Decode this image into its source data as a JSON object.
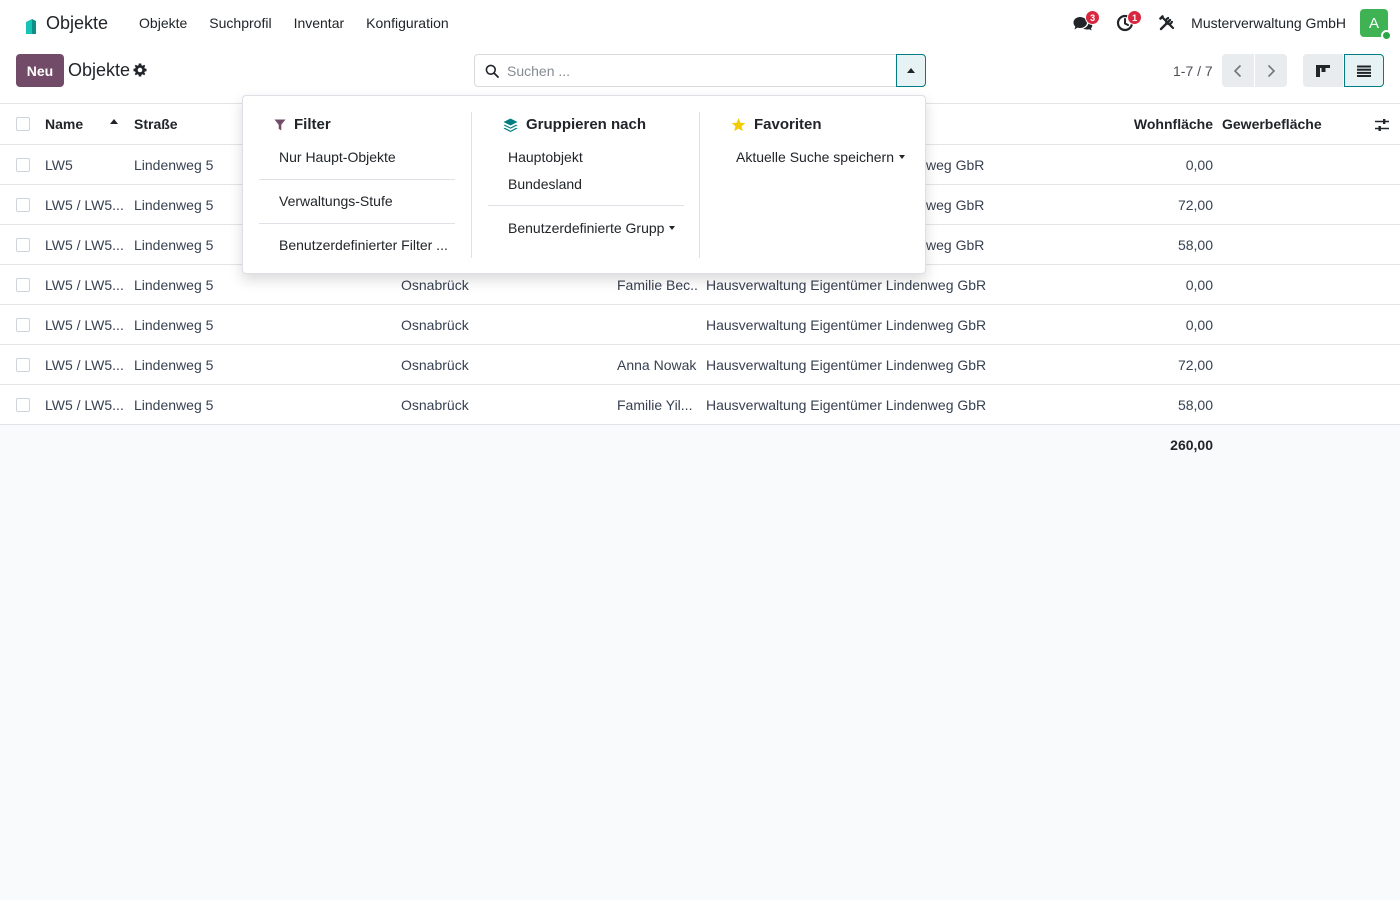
{
  "navbar": {
    "app_title": "Objekte",
    "menu": [
      "Objekte",
      "Suchprofil",
      "Inventar",
      "Konfiguration"
    ],
    "messages_badge": "3",
    "activities_badge": "1",
    "company": "Musterverwaltung GmbH",
    "avatar_initial": "A"
  },
  "control_panel": {
    "new_button": "Neu",
    "title": "Objekte",
    "search_placeholder": "Suchen ...",
    "pager": "1-7 / 7"
  },
  "table": {
    "columns": [
      "Name",
      "Straße",
      "Wohnfläche",
      "Gewerbefläche"
    ],
    "rows": [
      {
        "name": "LW5",
        "street": "Lindenweg 5",
        "city": "",
        "tenant": "",
        "owner": "weg GbR",
        "wohnflaeche": "0,00"
      },
      {
        "name": "LW5 / LW5...",
        "street": "Lindenweg 5",
        "city": "",
        "tenant": "",
        "owner": "weg GbR",
        "wohnflaeche": "72,00"
      },
      {
        "name": "LW5 / LW5...",
        "street": "Lindenweg 5",
        "city": "",
        "tenant": "",
        "owner": "weg GbR",
        "wohnflaeche": "58,00"
      },
      {
        "name": "LW5 / LW5...",
        "street": "Lindenweg 5",
        "city": "Osnabrück",
        "tenant": "Familie Bec...",
        "owner": "Hausverwaltung Eigentümer Lindenweg GbR",
        "wohnflaeche": "0,00"
      },
      {
        "name": "LW5 / LW5...",
        "street": "Lindenweg 5",
        "city": "Osnabrück",
        "tenant": "",
        "owner": "Hausverwaltung Eigentümer Lindenweg GbR",
        "wohnflaeche": "0,00"
      },
      {
        "name": "LW5 / LW5...",
        "street": "Lindenweg 5",
        "city": "Osnabrück",
        "tenant": "Anna Nowak",
        "owner": "Hausverwaltung Eigentümer Lindenweg GbR",
        "wohnflaeche": "72,00"
      },
      {
        "name": "LW5 / LW5...",
        "street": "Lindenweg 5",
        "city": "Osnabrück",
        "tenant": "Familie Yil...",
        "owner": "Hausverwaltung Eigentümer Lindenweg GbR",
        "wohnflaeche": "58,00"
      }
    ],
    "total_wohnflaeche": "260,00"
  },
  "search_panel": {
    "filter": {
      "heading": "Filter",
      "items": [
        "Nur Haupt-Objekte",
        "Verwaltungs-Stufe",
        "Benutzerdefinierter Filter ..."
      ]
    },
    "group_by": {
      "heading": "Gruppieren nach",
      "items": [
        "Hauptobjekt",
        "Bundesland"
      ],
      "custom": "Benutzerdefinierte Grupp"
    },
    "favorites": {
      "heading": "Favoriten",
      "save_search": "Aktuelle Suche speichern"
    }
  },
  "colors": {
    "primary": "#714b67",
    "accent": "#017e84",
    "badge": "#d8283f",
    "avatar": "#3fb354",
    "filter_icon": "#714b67",
    "group_icon": "#017e84",
    "favorite_icon": "#f3cc00"
  }
}
